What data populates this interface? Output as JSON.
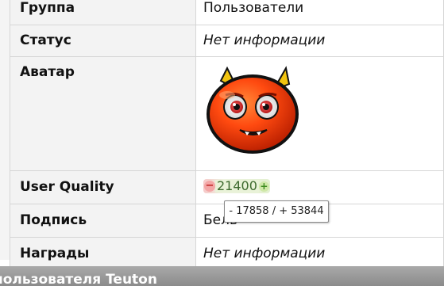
{
  "profile": {
    "group_label": "Группа",
    "group_value": "Пользователи",
    "status_label": "Статус",
    "status_value": "Нет информации",
    "avatar_label": "Аватар",
    "quality_label": "User Quality",
    "quality_value": "21400",
    "quality_minus": "−",
    "quality_plus": "+",
    "signature_label": "Подпись",
    "signature_value": "Бель",
    "awards_label": "Награды",
    "awards_value": "Нет информации"
  },
  "tooltip": {
    "text": "- 17858 / + 53844"
  },
  "footer": {
    "text": "пользователя Teuton"
  },
  "colors": {
    "label_bg": "#f3f3f3",
    "border": "#d6d6d6",
    "footer_bg": "#9a9a9a",
    "avatar_red": "#e83a10",
    "horn_yellow": "#f2c40f"
  },
  "icons": {
    "avatar": "red-devil-avatar",
    "minus": "minus-icon",
    "plus": "plus-icon"
  }
}
